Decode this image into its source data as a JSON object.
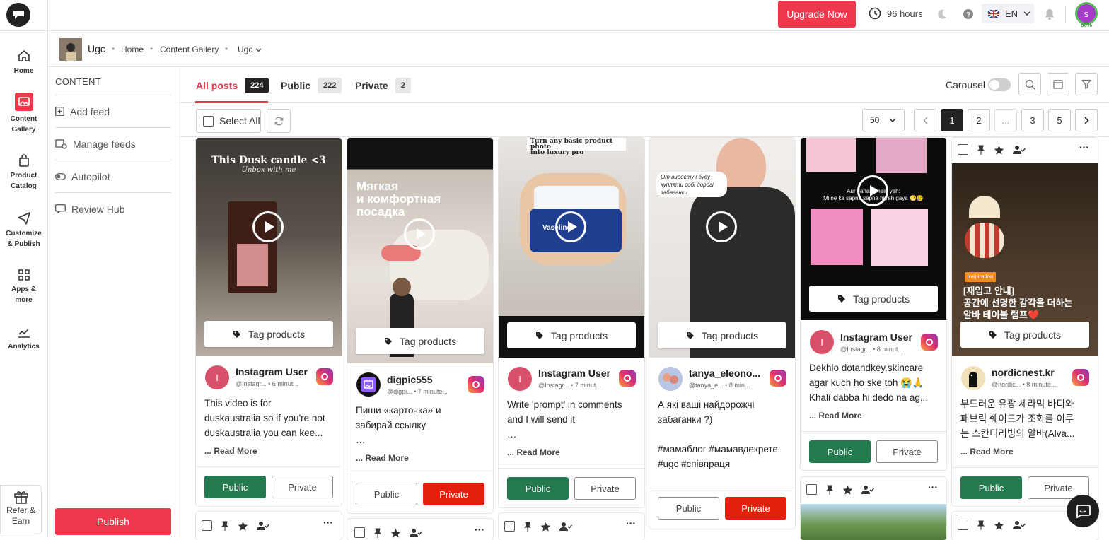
{
  "topbar": {
    "upgrade_label": "Upgrade Now",
    "hours_label": "96 hours",
    "language": "EN",
    "avatar_letter": "s",
    "progress_label": "50%",
    "progress_value": 0.5
  },
  "nav": {
    "items": [
      {
        "label": "Home",
        "icon": "home-icon"
      },
      {
        "label": "Content Gallery",
        "icon": "image-icon"
      },
      {
        "label": "Product Catalog",
        "icon": "bag-icon"
      },
      {
        "label": "Customize & Publish",
        "icon": "send-icon"
      },
      {
        "label": "Apps & more",
        "icon": "grid-icon"
      },
      {
        "label": "Analytics",
        "icon": "chart-icon"
      }
    ],
    "refer_label": "Refer & Earn"
  },
  "breadcrumb": {
    "title": "Ugc",
    "home": "Home",
    "gallery": "Content Gallery",
    "current": "Ugc"
  },
  "sidemenu": {
    "heading": "CONTENT",
    "items": [
      "Add feed",
      "Manage feeds",
      "Autopilot",
      "Review Hub"
    ],
    "publish_label": "Publish"
  },
  "tabs": {
    "all_label": "All posts",
    "all_count": "224",
    "public_label": "Public",
    "public_count": "222",
    "private_label": "Private",
    "private_count": "2",
    "carousel_label": "Carousel"
  },
  "toolbar": {
    "select_all": "Select All",
    "per_page": "50",
    "pages": [
      "1",
      "2",
      "...",
      "3",
      "5"
    ]
  },
  "common": {
    "tag_products": "Tag products",
    "read_more": "... Read More",
    "public": "Public",
    "private": "Private"
  },
  "cards": [
    {
      "media_text": "This Dusk candle <3",
      "media_sub": "Unbox with me",
      "user": "Instagram User",
      "meta": "@Instagr... • 6 minut...",
      "caption": "This video is for\nduskaustralia so if you're not\nduskaustralia you can kee...",
      "status": "Public"
    },
    {
      "media_text": "Мягкая\nи комфортная\nпосадка",
      "user": "digpic555",
      "meta": "@digpi... • 7 minute...",
      "caption": "Пиши «карточка» и\nзабирай ссылку\n…",
      "status": "Private"
    },
    {
      "media_text": "Turn any basic product photo\ninto luxury pro",
      "media_sub": "Vaseline",
      "user": "Instagram User",
      "meta": "@Instagr... • 7 minut...",
      "caption": "Write 'prompt' in comments\nand I will send it\n…",
      "status": "Public"
    },
    {
      "media_text": "От виросту і буду\nкупляти собі дорогі\nзабаганки",
      "user": "tanya_eleono...",
      "meta": "@tanya_e... • 8 min...",
      "caption": "А які ваші найдорожчі\nзабаганки ?)\n\n#мамаблог #мамавдекрете\n#ugc #співпраця",
      "status": "Private"
    },
    {
      "media_text": "Aur Janam mein yeh:\nMilne ka sapna sapna hi reh gaya 😬😢",
      "user": "Instagram User",
      "meta": "@Instagr... • 8 minut...",
      "caption": "Dekhlo dotandkey.skincare\nagar kuch ho ske toh 😭🙏\nKhali dabba hi dedo na ag...",
      "status": "Public"
    },
    {
      "media_text": "[재입고 안내]\n공간에 선명한 감각을 더하는\n알바 테이블 램프❤️",
      "media_badge": "Inspiration",
      "user": "nordicnest.kr",
      "meta": "@nordic... • 8 minute...",
      "caption": "부드러운 유광 세라믹 바디와\n패브릭 쉐이드가 조화를 이루\n는 스칸디리빙의 알바(Alva...",
      "status": "Public"
    }
  ],
  "colors": {
    "accent": "#f0384d",
    "public_green": "#237a4e",
    "private_red": "#e3200d",
    "active_tab": "#e03a4d"
  }
}
